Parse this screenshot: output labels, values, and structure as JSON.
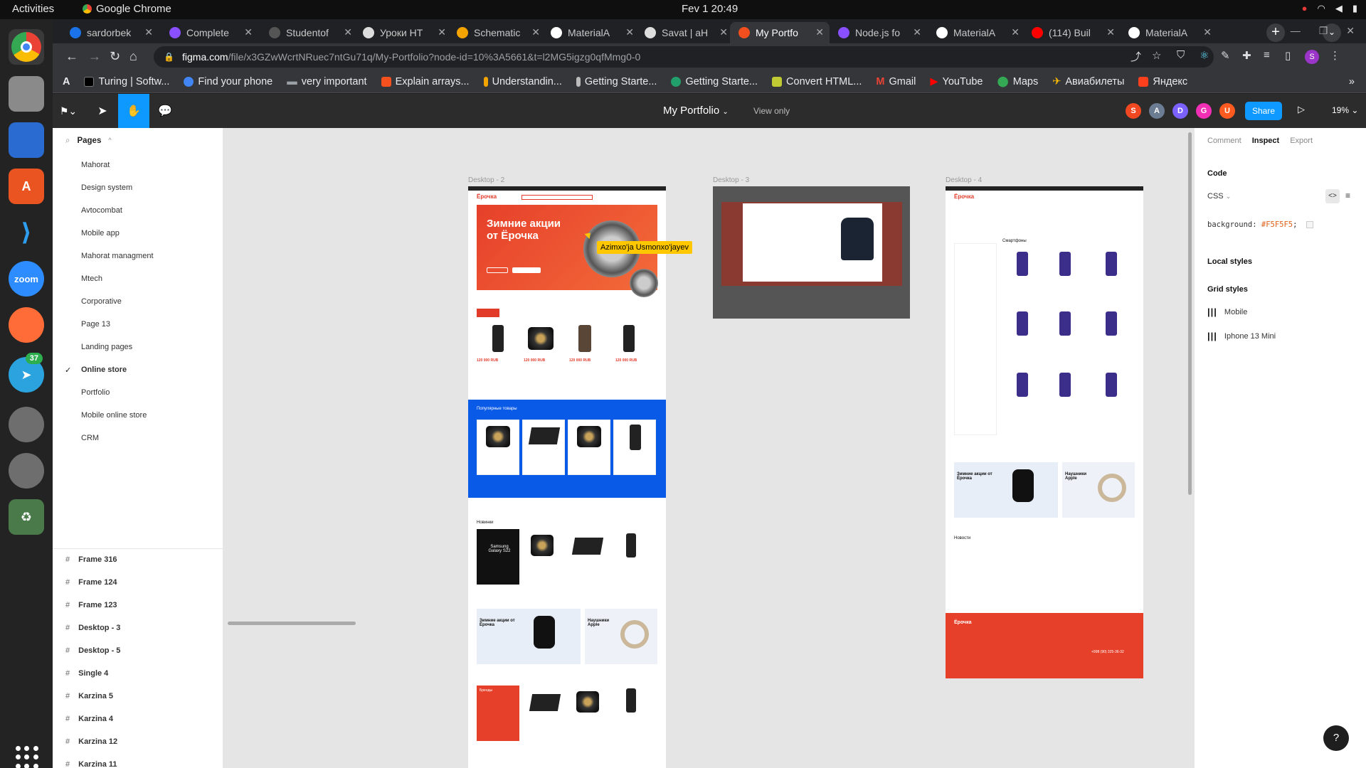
{
  "system": {
    "activities": "Activities",
    "app_name": "Google Chrome",
    "clock": "Fev 1  20:49",
    "telegram_badge": "37"
  },
  "browser": {
    "tabs": [
      {
        "label": "sardorbek",
        "color": "#1a73e8"
      },
      {
        "label": "Complete",
        "color": "#8a4fff"
      },
      {
        "label": "Studentof",
        "color": "#555555"
      },
      {
        "label": "Уроки HT",
        "color": "#dddddd"
      },
      {
        "label": "Schematic",
        "color": "#f4a400"
      },
      {
        "label": "MaterialA",
        "color": "#ffffff"
      },
      {
        "label": "Savat | aH",
        "color": "#dddddd"
      },
      {
        "label": "My Portfo",
        "color": "#f24e1e"
      },
      {
        "label": "Node.js fo",
        "color": "#8a4fff"
      },
      {
        "label": "MaterialA",
        "color": "#ffffff"
      },
      {
        "label": "(114) Buil",
        "color": "#ff0000"
      },
      {
        "label": "MaterialA",
        "color": "#ffffff"
      }
    ],
    "url_host": "figma.com",
    "url_path": "/file/x3GZwWcrtNRuec7ntGu71q/My-Portfolio?node-id=10%3A5661&t=l2MG5igzg0qfMmg0-0",
    "bookmarks": [
      {
        "label": "Turing | Softw...",
        "color": "#000000"
      },
      {
        "label": "Find your phone",
        "color": "#4285f4"
      },
      {
        "label": "very important",
        "color": "#9aa0a6"
      },
      {
        "label": "Explain arrays...",
        "color": "#f4511e"
      },
      {
        "label": "Understandin...",
        "color": "#f4a400"
      },
      {
        "label": "Getting Starte...",
        "color": "#bbbbbb"
      },
      {
        "label": "Getting Starte...",
        "color": "#22a06b"
      },
      {
        "label": "Convert HTML...",
        "color": "#c0ca33"
      },
      {
        "label": "Gmail",
        "color": "#ea4335"
      },
      {
        "label": "YouTube",
        "color": "#ff0000"
      },
      {
        "label": "Maps",
        "color": "#34a853"
      },
      {
        "label": "Авиабилеты",
        "color": "#fbbc04"
      },
      {
        "label": "Яндекс",
        "color": "#fc3f1d"
      }
    ]
  },
  "figma": {
    "file_title": "My Portfolio",
    "mode": "View only",
    "avatars": [
      {
        "letter": "S",
        "color": "#f24822"
      },
      {
        "letter": "A",
        "color": "#6b7c93"
      },
      {
        "letter": "D",
        "color": "#7b61ff"
      },
      {
        "letter": "G",
        "color": "#f02fb4"
      },
      {
        "letter": "U",
        "color": "#ff5a1f"
      }
    ],
    "share_label": "Share",
    "zoom": "19%"
  },
  "left_panel": {
    "pages_label": "Pages",
    "pages": [
      "Mahorat",
      "Design system",
      "Avtocombat",
      "Mobile app",
      "Mahorat managment",
      "Mtech",
      "Corporative",
      "Page 13",
      "Landing pages",
      "Online store",
      "Portfolio",
      "Mobile online store",
      "CRM"
    ],
    "current_page": "Online store",
    "layers": [
      "Frame 316",
      "Frame 124",
      "Frame 123",
      "Desktop - 3",
      "Desktop - 5",
      "Single 4",
      "Karzina 5",
      "Karzina 4",
      "Karzina 12",
      "Karzina 11"
    ]
  },
  "canvas": {
    "frame_labels": [
      "Desktop - 2",
      "Desktop - 3",
      "Desktop - 4"
    ],
    "hero_title": "Зимние акции от Ёрочка",
    "brand": "Ёрочка",
    "cursor_tooltip": "Azimxo'ja Usmonxo'jayev",
    "popular_label": "Популярные товары",
    "new_label": "Новинки",
    "smartphones_label": "Смартфоны",
    "news_label": "Новости",
    "headphones_label": "Наушники Apple",
    "watch_label": "Зимние акции от Ёрочка",
    "brands_label": "Бренды",
    "galaxy_label": "Samsung Galaxy S22",
    "price": "120 000 RUB",
    "phone_number": "+998 (90) 325-36-32"
  },
  "right_panel": {
    "tabs": [
      "Comment",
      "Inspect",
      "Export"
    ],
    "active_tab": "Inspect",
    "code_label": "Code",
    "lang": "CSS",
    "code_prop": "background:",
    "code_value": "#F5F5F5",
    "local_styles": "Local styles",
    "grid_styles": "Grid styles",
    "grids": [
      "Mobile",
      "Iphone 13 Mini"
    ]
  },
  "help_label": "?"
}
